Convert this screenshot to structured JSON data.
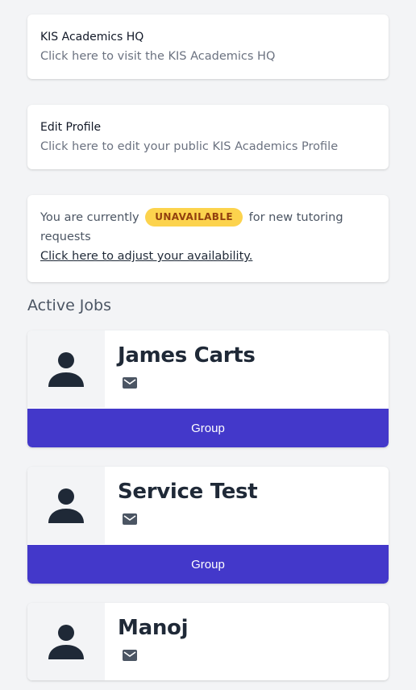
{
  "links": [
    {
      "title": "KIS Academics HQ",
      "subtitle": "Click here to visit the KIS Academics HQ"
    },
    {
      "title": "Edit Profile",
      "subtitle": "Click here to edit your public KIS Academics Profile"
    }
  ],
  "availability": {
    "prefix": "You are currently",
    "status": "UNAVAILABLE",
    "suffix": "for new tutoring requests",
    "adjust_link": "Click here to adjust your availability."
  },
  "active_jobs": {
    "heading": "Active Jobs",
    "jobs": [
      {
        "name": "James Carts",
        "button": "Group",
        "icon": "mail-icon"
      },
      {
        "name": "Service Test",
        "button": "Group",
        "icon": "mail-icon"
      },
      {
        "name": "Manoj",
        "icon": "mail-icon"
      }
    ]
  },
  "colors": {
    "accent": "#4338ca",
    "badge_bg": "#fcd34d",
    "badge_text": "#92400e",
    "background": "#f3f4f6"
  }
}
